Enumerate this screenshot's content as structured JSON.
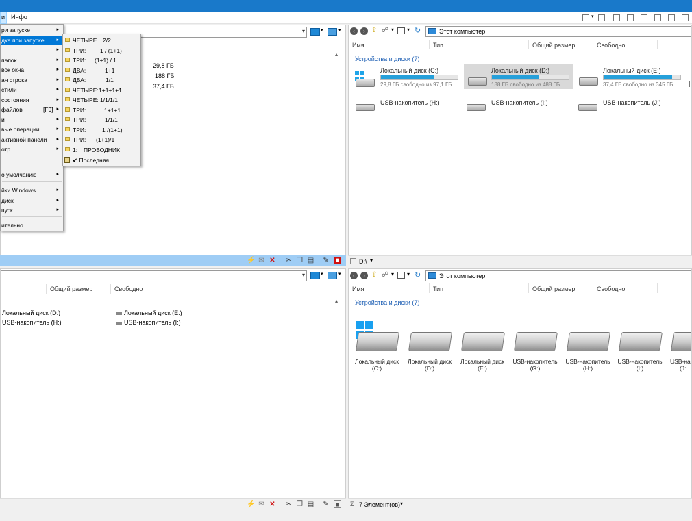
{
  "menubar": {
    "partial_item": "и",
    "info": "Инфо"
  },
  "left_menu": {
    "items": [
      {
        "label": "ри запуске",
        "arrow": "▸"
      },
      {
        "label": "дка при запуске",
        "arrow": "▸",
        "selected": true
      },
      {
        "label": "",
        "arrow": "▸"
      },
      {
        "label": " папок",
        "arrow": "▸"
      },
      {
        "label": "вок окна",
        "arrow": "▸"
      },
      {
        "label": "ая строка",
        "arrow": "▸"
      },
      {
        "label": "стили",
        "arrow": "▸"
      },
      {
        "label": " состояния",
        "arrow": "▸"
      },
      {
        "label": " файлов",
        "shortcut": "[F9]",
        "arrow": "▸"
      },
      {
        "label": "и",
        "arrow": "▸"
      },
      {
        "label": "вые операции",
        "arrow": "▸"
      },
      {
        "label": " активной панели",
        "arrow": "▸"
      },
      {
        "label": "отр",
        "arrow": "▸"
      },
      {
        "label": "о умолчанию",
        "arrow": "▸"
      },
      {
        "label": "йки Windows",
        "arrow": "▸"
      },
      {
        "label": " диск",
        "arrow": "▸"
      },
      {
        "label": "пуск",
        "arrow": "▸"
      },
      {
        "label": "ительно...",
        "arrow": ""
      }
    ]
  },
  "submenu": {
    "items": [
      {
        "key": "ЧЕТЫРЕ",
        "val": "2/2"
      },
      {
        "key": "ТРИ:",
        "val": "1   / (1+1)"
      },
      {
        "key": "ТРИ:",
        "val": "(1+1) /    1"
      },
      {
        "key": "ДВА:",
        "val": "1+1"
      },
      {
        "key": "ДВА:",
        "val": "1/1"
      },
      {
        "key": "ЧЕТЫРЕ:",
        "val": "1+1+1+1"
      },
      {
        "key": "ЧЕТЫРЕ:",
        "val": "1/1/1/1"
      },
      {
        "key": "ТРИ:",
        "val": "1+1+1"
      },
      {
        "key": "ТРИ:",
        "val": "1/1/1"
      },
      {
        "key": "ТРИ:",
        "val": "1  /(1+1)"
      },
      {
        "key": "ТРИ:",
        "val": "(1+1)/1"
      },
      {
        "key": "1:",
        "val": "ПРОВОДНИК"
      }
    ],
    "last": "✔  Последняя"
  },
  "top_left_pane": {
    "sizes": [
      "29,8 ГБ",
      "188 ГБ",
      "37,4 ГБ"
    ]
  },
  "top_right_pane": {
    "address": "Этот компьютер",
    "columns": [
      "Имя",
      "Тип",
      "Общий размер",
      "Свободно"
    ],
    "group": "Устройства и диски (7)",
    "drives": [
      {
        "name": "Локальный диск (C:)",
        "sub": "29,8 ГБ свободно из 97,1 ГБ",
        "fill": 0.69
      },
      {
        "name": "Локальный диск (D:)",
        "sub": "188 ГБ свободно из 488 ГБ",
        "fill": 0.61
      },
      {
        "name": "Локальный диск (E:)",
        "sub": "37,4 ГБ свободно из 345 ГБ",
        "fill": 0.89
      }
    ],
    "usb": [
      "USB-накопитель (H:)",
      "USB-накопитель (I:)",
      "USB-накопитель (J:)"
    ],
    "status_path": "D:\\"
  },
  "bottom_left_pane": {
    "columns": [
      "Общий размер",
      "Свободно"
    ],
    "row1": [
      "Локальный диск (D:)",
      "Локальный диск (E:)"
    ],
    "row2": [
      "USB-накопитель (H:)",
      "USB-накопитель (I:)"
    ]
  },
  "bottom_right_pane": {
    "address": "Этот компьютер",
    "columns": [
      "Имя",
      "Тип",
      "Общий размер",
      "Свободно"
    ],
    "group": "Устройства и диски (7)",
    "tiles": [
      {
        "line1": "Локальный диск",
        "line2": "(C:)"
      },
      {
        "line1": "Локальный диск",
        "line2": "(D:)"
      },
      {
        "line1": "Локальный диск",
        "line2": "(E:)"
      },
      {
        "line1": "USB-накопитель",
        "line2": "(G:)"
      },
      {
        "line1": "USB-накопитель",
        "line2": "(H:)"
      },
      {
        "line1": "USB-накопитель",
        "line2": "(I:)"
      },
      {
        "line1": "USB-накопи",
        "line2": "(J:"
      }
    ],
    "status": "7 Элемент(ов)"
  },
  "colors": {
    "accent": "#0078d7",
    "titlebar": "#1979ca",
    "bar_fill": "#26a0da"
  }
}
